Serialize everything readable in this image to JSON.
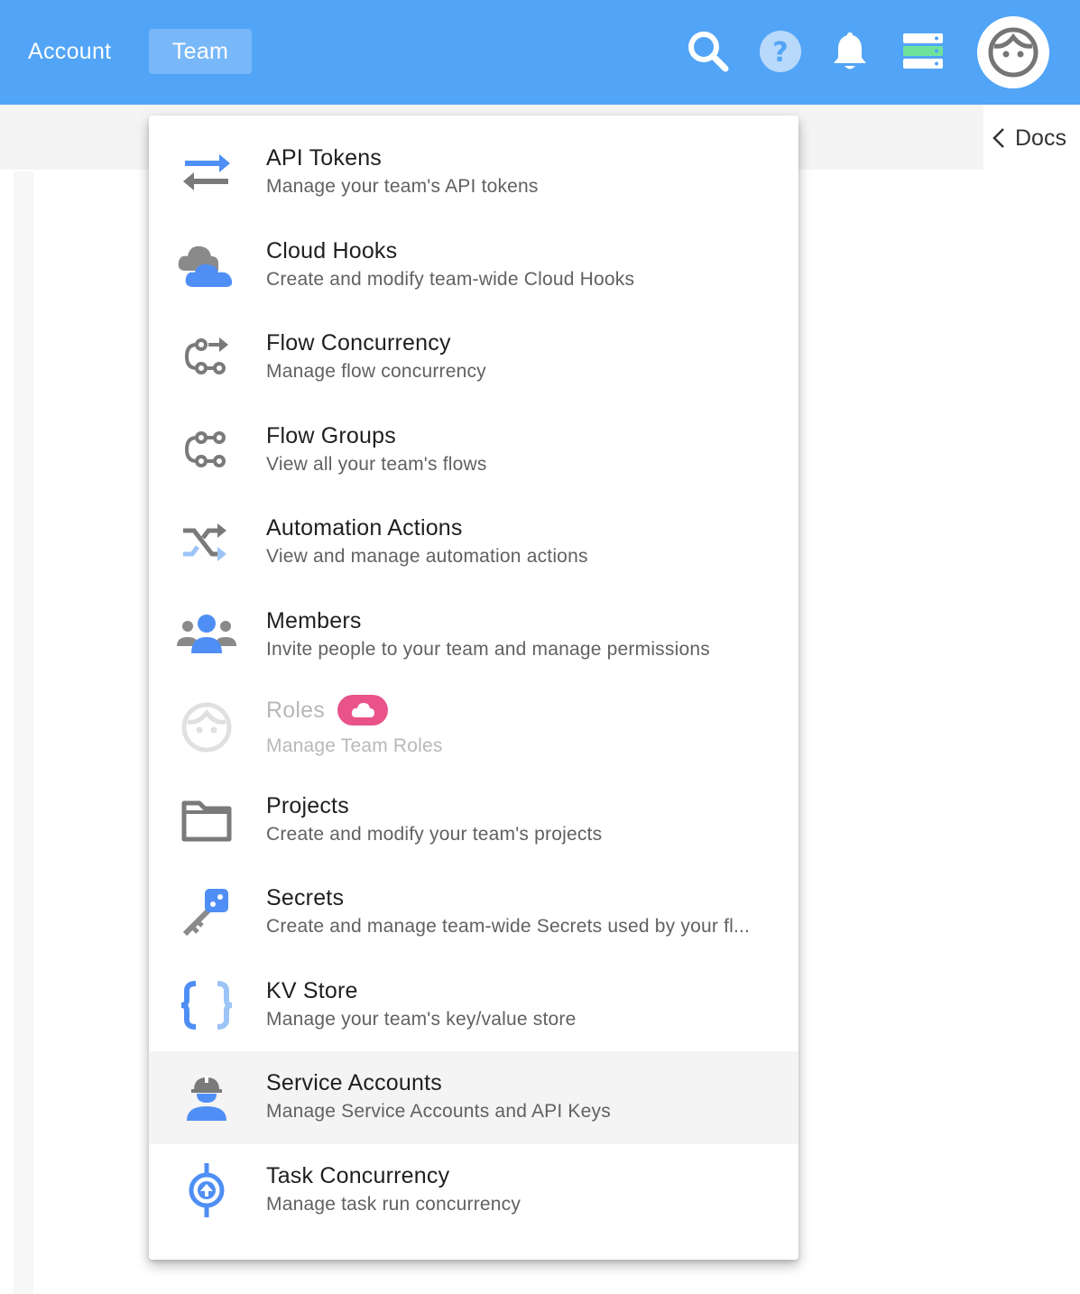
{
  "topbar": {
    "account_label": "Account",
    "team_label": "Team",
    "icons": [
      "search-icon",
      "help-icon",
      "bell-icon",
      "server-status-icon",
      "avatar-icon"
    ]
  },
  "docs": {
    "label": "Docs"
  },
  "colors": {
    "topbar": "#52a4f6",
    "icon_blue": "#4f8ff5",
    "icon_light_blue": "#9cc4f7",
    "icon_grey": "#7a7a7a",
    "badge_pink": "#e9538a",
    "server_green": "#6fe39b"
  },
  "menu": {
    "items": [
      {
        "title": "API Tokens",
        "subtitle": "Manage your team's API tokens",
        "icon": "swap-arrows-icon"
      },
      {
        "title": "Cloud Hooks",
        "subtitle": "Create and modify team-wide Cloud Hooks",
        "icon": "clouds-icon"
      },
      {
        "title": "Flow Concurrency",
        "subtitle": "Manage flow concurrency",
        "icon": "flow-concurrency-icon"
      },
      {
        "title": "Flow Groups",
        "subtitle": "View all your team's flows",
        "icon": "flow-groups-icon"
      },
      {
        "title": "Automation Actions",
        "subtitle": "View and manage automation actions",
        "icon": "shuffle-icon"
      },
      {
        "title": "Members",
        "subtitle": "Invite people to your team and manage permissions",
        "icon": "people-icon"
      },
      {
        "title": "Roles",
        "subtitle": "Manage Team Roles",
        "icon": "face-icon",
        "disabled": true,
        "badge": "cloud-badge-icon"
      },
      {
        "title": "Projects",
        "subtitle": "Create and modify your team's projects",
        "icon": "folder-icon"
      },
      {
        "title": "Secrets",
        "subtitle": "Create and manage team-wide Secrets used by your fl...",
        "icon": "key-icon"
      },
      {
        "title": "KV Store",
        "subtitle": "Manage your team's key/value store",
        "icon": "braces-icon"
      },
      {
        "title": "Service Accounts",
        "subtitle": "Manage Service Accounts and API Keys",
        "icon": "worker-icon",
        "active": true
      },
      {
        "title": "Task Concurrency",
        "subtitle": "Manage task run concurrency",
        "icon": "task-concurrency-icon"
      }
    ]
  }
}
